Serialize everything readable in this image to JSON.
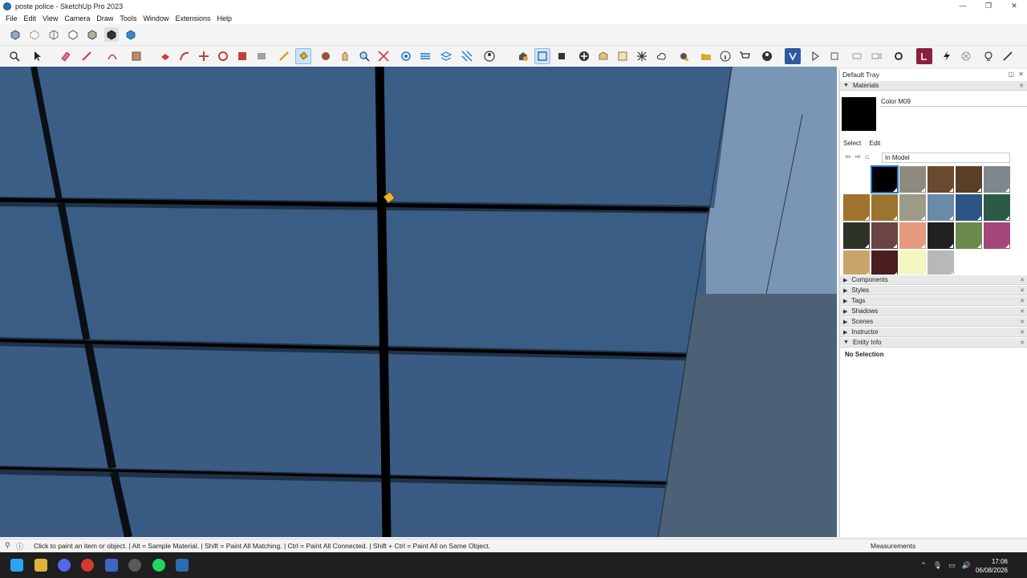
{
  "window": {
    "title": "poste police - SketchUp Pro 2023",
    "minimize": "—",
    "restore": "❐",
    "close": "✕"
  },
  "menu": [
    "File",
    "Edit",
    "View",
    "Camera",
    "Draw",
    "Tools",
    "Window",
    "Extensions",
    "Help"
  ],
  "tray": {
    "title": "Default Tray",
    "materials": {
      "header": "Materials",
      "current_name": "Color M09",
      "current_color": "#000000",
      "select_tab": "Select",
      "edit_tab": "Edit",
      "library": "In Model",
      "swatches": [
        "#ffffff",
        "#000000",
        "#8f8a80",
        "#6a4a2e",
        "#5a3e26",
        "#7d8790",
        "#a0722e",
        "#9c7431",
        "#9b9b86",
        "#6a8aa8",
        "#2c5585",
        "#2c5a45",
        "#2d3326",
        "#6b4444",
        "#e59a7d",
        "#212121",
        "#6b8a4d",
        "#a3477a",
        "#c8a56b",
        "#4a1e1e",
        "#f5f5c0",
        "#b8b8b8"
      ]
    },
    "panels": [
      "Components",
      "Styles",
      "Tags",
      "Shadows",
      "Scenes",
      "Instructor",
      "Entity Info"
    ],
    "entity_info": "No Selection"
  },
  "status": {
    "text": "Click to paint an item or object. | Alt = Sample Material. | Shift = Paint All Matching. | Ctrl = Paint All Connected. | Shift + Ctrl = Paint All on Same Object.",
    "measurements_label": "Measurements"
  },
  "taskbar": {
    "time": "17:06",
    "date": "06/08/2026"
  }
}
